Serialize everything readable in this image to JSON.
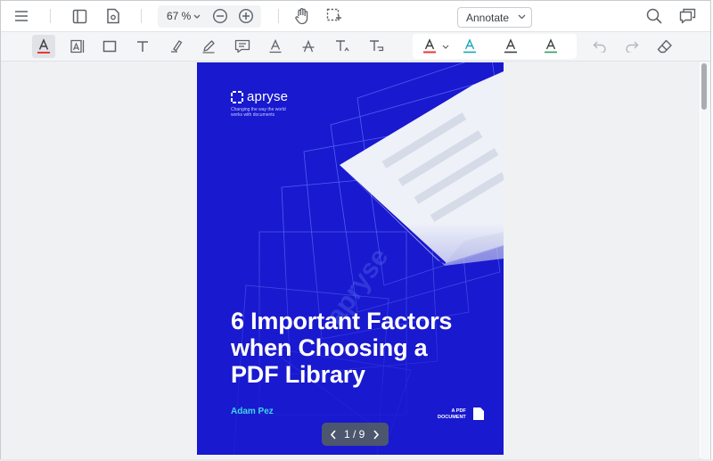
{
  "header": {
    "zoom_value": "67 %",
    "mode_label": "Annotate"
  },
  "document": {
    "brand": "apryse",
    "tagline": "Changing the way the world works with documents",
    "watermark": "apryse",
    "title_lines": [
      "6 Important Factors",
      "when Choosing a",
      "PDF Library"
    ],
    "author": "Adam Pez",
    "doc_label_line1": "A PDF",
    "doc_label_line2": "DOCUMENT"
  },
  "pager": {
    "current": "1",
    "total": "9",
    "display": "1 / 9"
  },
  "colors": {
    "page_bg": "#1919cf",
    "accent_author": "#3fd6e6",
    "underline_red": "#e53935",
    "underline_teal": "#1aa7b8",
    "underline_dark": "#3c4043",
    "underline_green": "#2e9e5b"
  },
  "icons": {
    "menu": "hamburger-menu-icon",
    "panel": "left-panel-icon",
    "settings_doc": "document-settings-icon",
    "zoom_out": "zoom-out-icon",
    "zoom_in": "zoom-in-icon",
    "pan": "hand-pan-icon",
    "select": "marquee-select-icon",
    "search": "search-icon",
    "comments": "comments-icon"
  }
}
